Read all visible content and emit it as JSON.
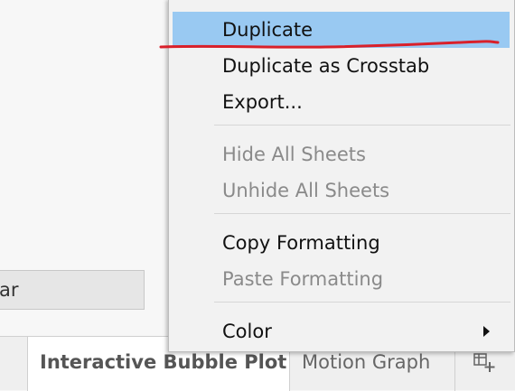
{
  "workspace": {
    "field_text": "ar"
  },
  "tabs": [
    {
      "label": "Interactive Bubble Plot",
      "active": true
    },
    {
      "label": "Motion Graph",
      "active": false
    }
  ],
  "context_menu": {
    "items": [
      {
        "label": "Duplicate",
        "enabled": true,
        "highlighted": true
      },
      {
        "label": "Duplicate as Crosstab",
        "enabled": true
      },
      {
        "label": "Export...",
        "enabled": true
      },
      {
        "label": "Hide All Sheets",
        "enabled": false
      },
      {
        "label": "Unhide All Sheets",
        "enabled": false
      },
      {
        "label": "Copy Formatting",
        "enabled": true
      },
      {
        "label": "Paste Formatting",
        "enabled": false
      },
      {
        "label": "Color",
        "enabled": true,
        "has_submenu": true
      }
    ]
  },
  "colors": {
    "highlight": "#99c9f2",
    "annotation_stroke": "#d9202a"
  },
  "icons": {
    "new_sheet": "new-worksheet-icon",
    "submenu": "submenu-arrow-icon"
  }
}
